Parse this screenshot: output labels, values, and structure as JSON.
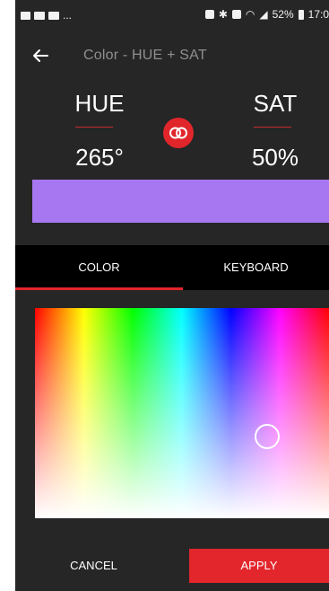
{
  "status_bar": {
    "left_icons": [
      "image-icon",
      "message-icon",
      "mail-icon"
    ],
    "ellipsis": "...",
    "battery_percent": "52%",
    "time": "17:0"
  },
  "app_bar": {
    "title": "Color - HUE + SAT"
  },
  "hue": {
    "label": "HUE",
    "value": "265°"
  },
  "sat": {
    "label": "SAT",
    "value": "50%"
  },
  "link_icon": "linked-rings-icon",
  "preview": {
    "color": "#a777f2"
  },
  "tabs": [
    {
      "label": "COLOR",
      "selected": true
    },
    {
      "label": "KEYBOARD",
      "selected": false
    }
  ],
  "picker": {
    "hue_degrees": 265,
    "saturation_percent": 50
  },
  "actions": {
    "cancel_label": "CANCEL",
    "apply_label": "APPLY"
  },
  "colors": {
    "background": "#262626",
    "accent": "#e3262c",
    "title_gray": "#8f8f8f",
    "tab_bar": "#000000"
  }
}
